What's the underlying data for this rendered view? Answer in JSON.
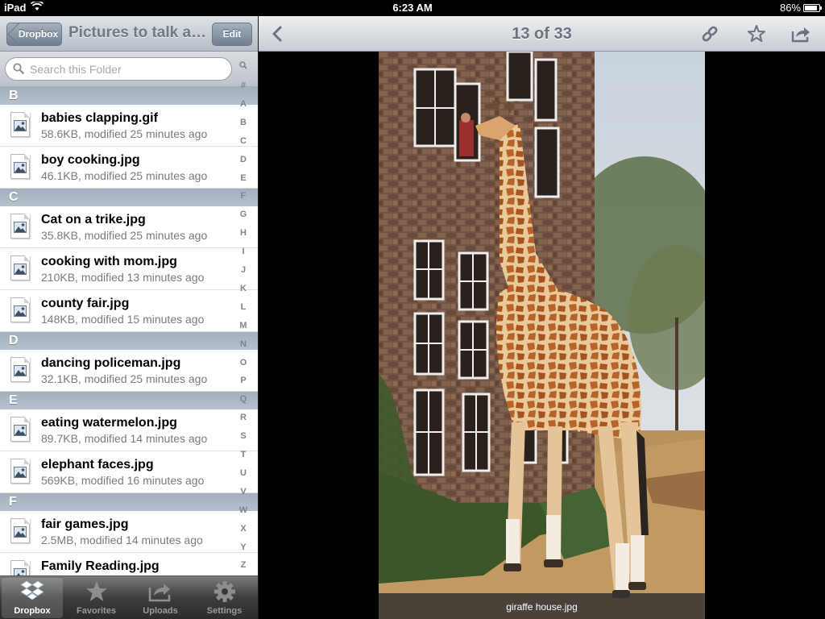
{
  "status_bar": {
    "carrier": "iPad",
    "time": "6:23 AM",
    "battery": "86%",
    "battery_level": 0.86
  },
  "left_panel": {
    "back_button": "Dropbox",
    "title": "Pictures to talk about",
    "edit_button": "Edit",
    "search": {
      "placeholder": "Search this Folder",
      "value": ""
    },
    "sections": [
      {
        "letter": "B",
        "files": [
          {
            "name": "babies clapping.gif",
            "meta": "58.6KB, modified 25 minutes ago"
          },
          {
            "name": "boy cooking.jpg",
            "meta": "46.1KB, modified 25 minutes ago"
          }
        ]
      },
      {
        "letter": "C",
        "files": [
          {
            "name": "Cat on a trike.jpg",
            "meta": "35.8KB, modified 25 minutes ago"
          },
          {
            "name": "cooking with mom.jpg",
            "meta": "210KB, modified 13 minutes ago"
          },
          {
            "name": "county fair.jpg",
            "meta": "148KB, modified 15 minutes ago"
          }
        ]
      },
      {
        "letter": "D",
        "files": [
          {
            "name": "dancing policeman.jpg",
            "meta": "32.1KB, modified 25 minutes ago"
          }
        ]
      },
      {
        "letter": "E",
        "files": [
          {
            "name": "eating watermelon.jpg",
            "meta": "89.7KB, modified 14 minutes ago"
          },
          {
            "name": "elephant faces.jpg",
            "meta": "569KB, modified 16 minutes ago"
          }
        ]
      },
      {
        "letter": "F",
        "files": [
          {
            "name": "fair games.jpg",
            "meta": "2.5MB, modified 14 minutes ago"
          },
          {
            "name": "Family Reading.jpg",
            "meta": ""
          }
        ]
      }
    ],
    "index": [
      "#",
      "A",
      "B",
      "C",
      "D",
      "E",
      "F",
      "G",
      "H",
      "I",
      "J",
      "K",
      "L",
      "M",
      "N",
      "O",
      "P",
      "Q",
      "R",
      "S",
      "T",
      "U",
      "V",
      "W",
      "X",
      "Y",
      "Z"
    ],
    "tabs": [
      {
        "label": "Dropbox",
        "icon": "dropbox-icon",
        "active": true
      },
      {
        "label": "Favorites",
        "icon": "star-icon",
        "active": false
      },
      {
        "label": "Uploads",
        "icon": "upload-icon",
        "active": false
      },
      {
        "label": "Settings",
        "icon": "gear-icon",
        "active": false
      }
    ]
  },
  "viewer": {
    "counter": "13 of 33",
    "caption": "giraffe house.jpg",
    "toolbar_icons": [
      "back-chevron-icon",
      "link-icon",
      "star-icon",
      "share-icon"
    ]
  },
  "colors": {
    "nav_gradient_top": "#dfe3e7",
    "section_header": "#a2afbc",
    "tabbar": "#2b2b2b",
    "photo_background": "#000000"
  }
}
